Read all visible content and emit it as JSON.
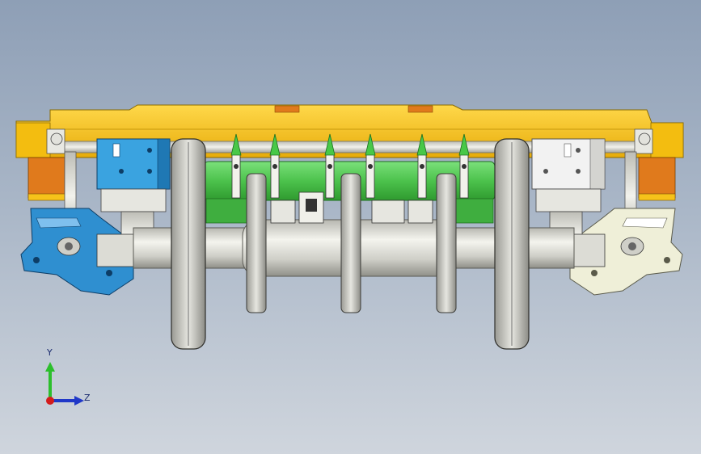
{
  "view": {
    "background_top": "#8e9fb6",
    "background_bottom": "#cfd5dd"
  },
  "model": {
    "frame_color": "#f6c21a",
    "frame_edge_color": "#b98b00",
    "orange_block_color": "#e07a1c",
    "gear_housing_color": "#3aa3e0",
    "gear_housing_right_color": "#eeeeee",
    "shaft_cover_color": "#5fd35f",
    "blue_bracket_color": "#2f8fd0",
    "cream_bracket_color": "#efefd8",
    "axle_color": "#d9d9d2",
    "wheel_color": "#c8c8c2",
    "lever_tip_color": "#48c848"
  },
  "triad": {
    "y_label": "Y",
    "z_label": "Z",
    "y_color": "#2cbf2c",
    "z_color": "#2038c8",
    "x_color": "#d41c1c"
  }
}
